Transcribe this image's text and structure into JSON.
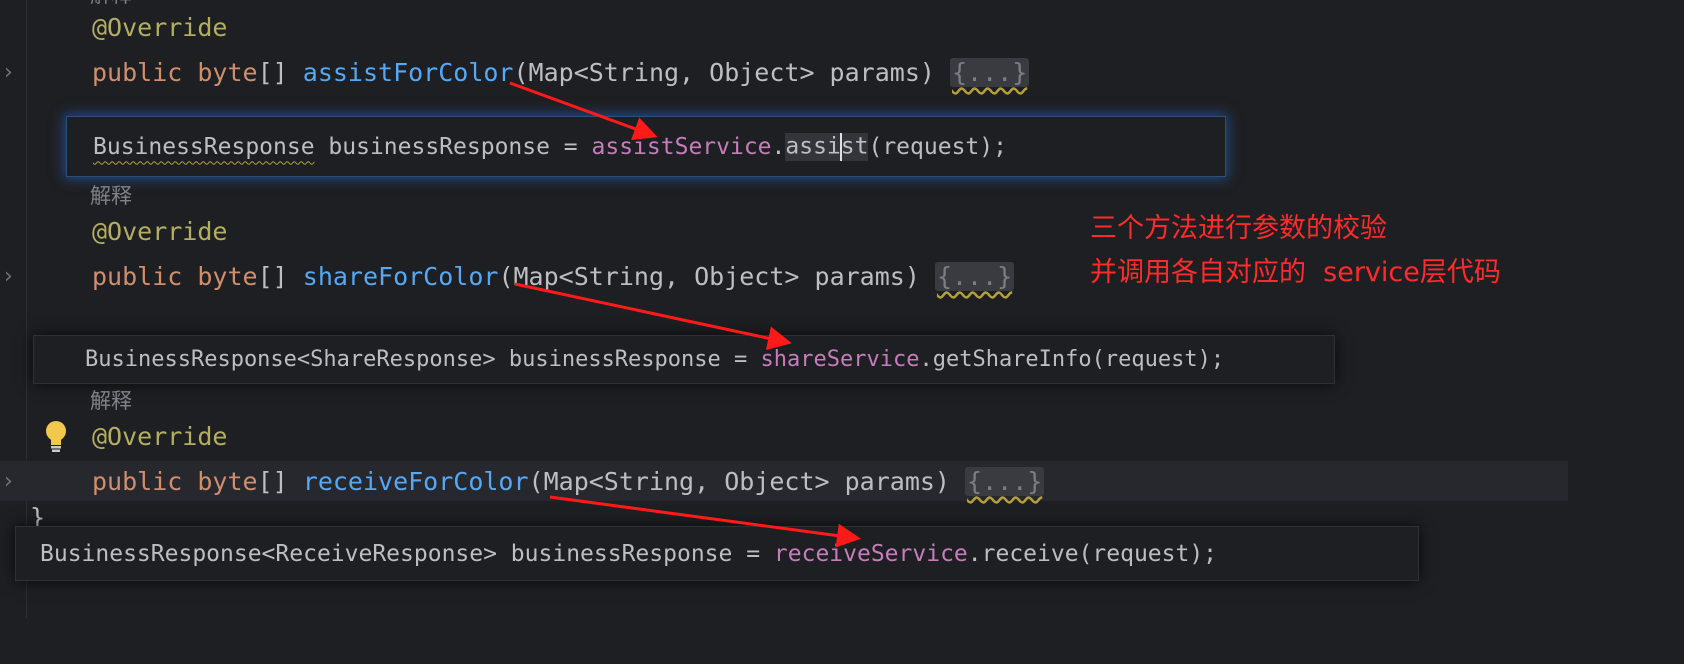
{
  "code": {
    "hint_top": "解释",
    "override": "@Override",
    "kw_public": "public",
    "kw_byte": "byte",
    "brackets": "[]",
    "fold": "{...}",
    "params_sig": "(Map<String, Object> params)",
    "method_assist": "assistForColor",
    "method_share": "shareForColor",
    "method_receive": "receiveForColor",
    "hint": "解释",
    "closing_brace": "}"
  },
  "popups": {
    "assist": {
      "type": "BusinessResponse",
      "var": " businessResponse = ",
      "service": "assistService",
      "dot": ".",
      "method_a": "assi",
      "method_b": "st",
      "args": "(request);"
    },
    "share": {
      "prefix": "BusinessResponse<ShareResponse> businessResponse = ",
      "service": "shareService",
      "rest": ".getShareInfo(request);"
    },
    "receive": {
      "prefix": "BusinessResponse<ReceiveResponse> businessResponse = ",
      "service": "receiveService",
      "rest": ".receive(request);"
    }
  },
  "annotation": {
    "line1": "三个方法进行参数的校验",
    "line2": "并调用各自对应的  service层代码"
  },
  "icons": {
    "fold_chevron": "chevron-right-icon",
    "intention_bulb": "lightbulb-icon"
  },
  "colors": {
    "background": "#1e1f22",
    "keyword": "#cf8e6d",
    "annotation": "#b3ae60",
    "method": "#56a8f5",
    "field": "#c77dbb",
    "arrow": "#ff1a1a"
  }
}
